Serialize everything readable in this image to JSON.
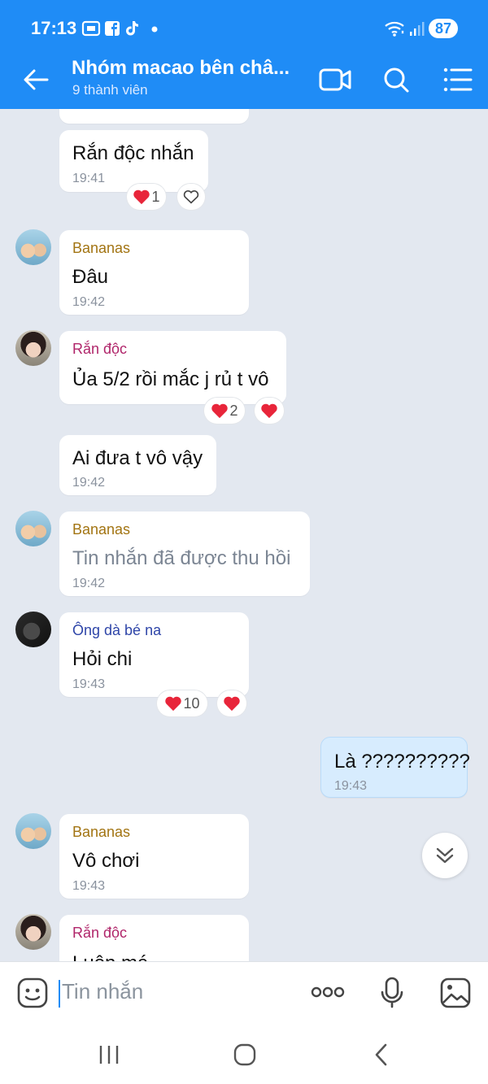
{
  "status_bar": {
    "time": "17:13",
    "battery": "87"
  },
  "header": {
    "title": "Nhóm macao bên châ...",
    "subtitle": "9 thành viên"
  },
  "colors": {
    "header_bg": "#1f8cf6",
    "chat_bg": "#e3e8f0",
    "heart": "#e8253a",
    "accent": "#1f8cf6"
  },
  "messages": [
    {
      "text": "Rắn độc nhắn",
      "time": "19:41",
      "reaction_count": "1"
    },
    {
      "sender": "Bananas",
      "text": "Đâu",
      "time": "19:42"
    },
    {
      "sender": "Rắn độc",
      "text": "Ủa 5/2 rồi mắc j rủ t vô",
      "reaction_count": "2"
    },
    {
      "text": "Ai đưa t vô vậy",
      "time": "19:42"
    },
    {
      "sender": "Bananas",
      "text": "Tin nhắn đã được thu hồi",
      "time": "19:42"
    },
    {
      "sender": "Ông dà bé na",
      "text": "Hỏi chi",
      "time": "19:43",
      "reaction_count": "10"
    },
    {
      "text": "Là ??????????",
      "time": "19:43",
      "mine": true
    },
    {
      "sender": "Bananas",
      "text": "Vô chơi",
      "time": "19:43"
    },
    {
      "sender": "Rắn độc",
      "text": "Luôn má"
    }
  ],
  "input": {
    "placeholder": "Tin nhắn"
  }
}
